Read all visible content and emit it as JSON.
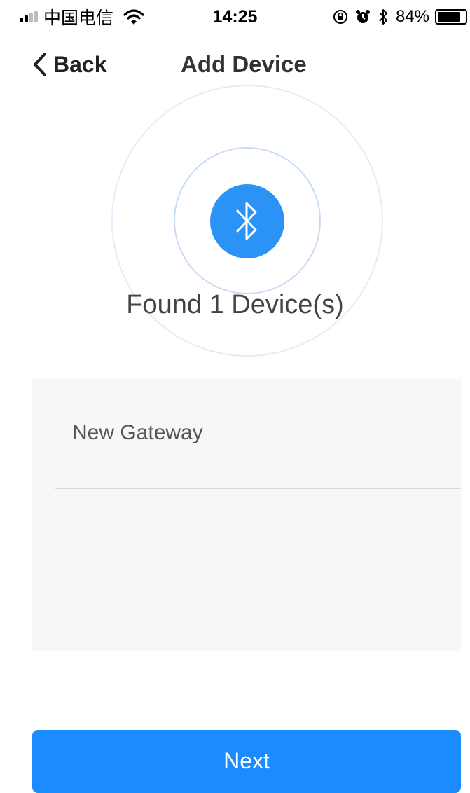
{
  "status_bar": {
    "carrier": "中国电信",
    "time": "14:25",
    "battery_percent": "84%",
    "battery_level": 0.84,
    "icons": [
      "signal-icon",
      "wifi-icon",
      "orientation-lock-icon",
      "alarm-icon",
      "bluetooth-icon",
      "battery-icon"
    ]
  },
  "nav": {
    "back_label": "Back",
    "title": "Add Device"
  },
  "scan": {
    "icon": "bluetooth-icon",
    "found_text": "Found 1 Device(s)"
  },
  "devices": [
    {
      "name": "New Gateway"
    }
  ],
  "actions": {
    "next_label": "Next"
  },
  "colors": {
    "accent": "#1a8cff",
    "panel": "#f7f7f7"
  }
}
